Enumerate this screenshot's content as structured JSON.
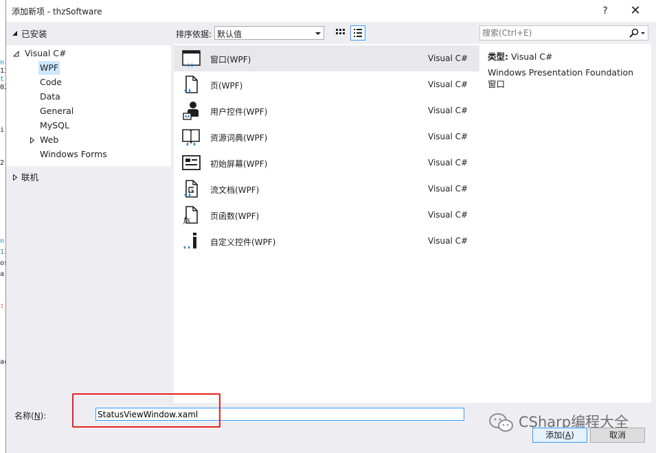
{
  "background_code_glyphs": [
    "n",
    "13",
    "t",
    "02",
    "i:",
    "2[",
    "n.",
    "13",
    "os",
    "a:",
    ":",
    "ac"
  ],
  "window": {
    "title": "添加新项 - thzSoftware",
    "help_glyph": "?",
    "close_glyph": "✕"
  },
  "left_panel": {
    "installed_label": "已安装",
    "tree": [
      {
        "label": "Visual C#",
        "level": 0,
        "expanded": true
      },
      {
        "label": "WPF",
        "level": 1,
        "selected": true
      },
      {
        "label": "Code",
        "level": 1
      },
      {
        "label": "Data",
        "level": 1
      },
      {
        "label": "General",
        "level": 1
      },
      {
        "label": "MySQL",
        "level": 1
      },
      {
        "label": "Web",
        "level": 1,
        "collapsed": true
      },
      {
        "label": "Windows Forms",
        "level": 1
      }
    ],
    "online_label": "联机"
  },
  "toolbar": {
    "sort_label": "排序依据:",
    "sort_value": "默认值"
  },
  "search": {
    "placeholder": "搜索(Ctrl+E)"
  },
  "templates": [
    {
      "name": "窗口(WPF)",
      "lang": "Visual C#",
      "icon": "window-icon",
      "selected": true
    },
    {
      "name": "页(WPF)",
      "lang": "Visual C#",
      "icon": "page-icon"
    },
    {
      "name": "用户控件(WPF)",
      "lang": "Visual C#",
      "icon": "user-control-icon"
    },
    {
      "name": "资源词典(WPF)",
      "lang": "Visual C#",
      "icon": "resource-dictionary-icon"
    },
    {
      "name": "初始屏幕(WPF)",
      "lang": "Visual C#",
      "icon": "splash-screen-icon"
    },
    {
      "name": "流文档(WPF)",
      "lang": "Visual C#",
      "icon": "flow-document-icon"
    },
    {
      "name": "页函数(WPF)",
      "lang": "Visual C#",
      "icon": "page-function-icon"
    },
    {
      "name": "自定义控件(WPF)",
      "lang": "Visual C#",
      "icon": "custom-control-icon"
    }
  ],
  "info": {
    "type_label": "类型:",
    "type_value": "Visual C#",
    "description": "Windows Presentation Foundation 窗口"
  },
  "bottom": {
    "name_label_pre": "名称(",
    "name_label_key": "N",
    "name_label_post": "):",
    "name_value": "StatusViewWindow.xaml",
    "add_pre": "添加(",
    "add_key": "A",
    "add_post": ")",
    "cancel_label": "取消",
    "watermark": "CSharp编程大全"
  },
  "colors": {
    "accent": "#3399ff",
    "selection": "#cce8ff",
    "highlight_box": "#e8201a",
    "wpf_blue": "#1e7fc5"
  }
}
